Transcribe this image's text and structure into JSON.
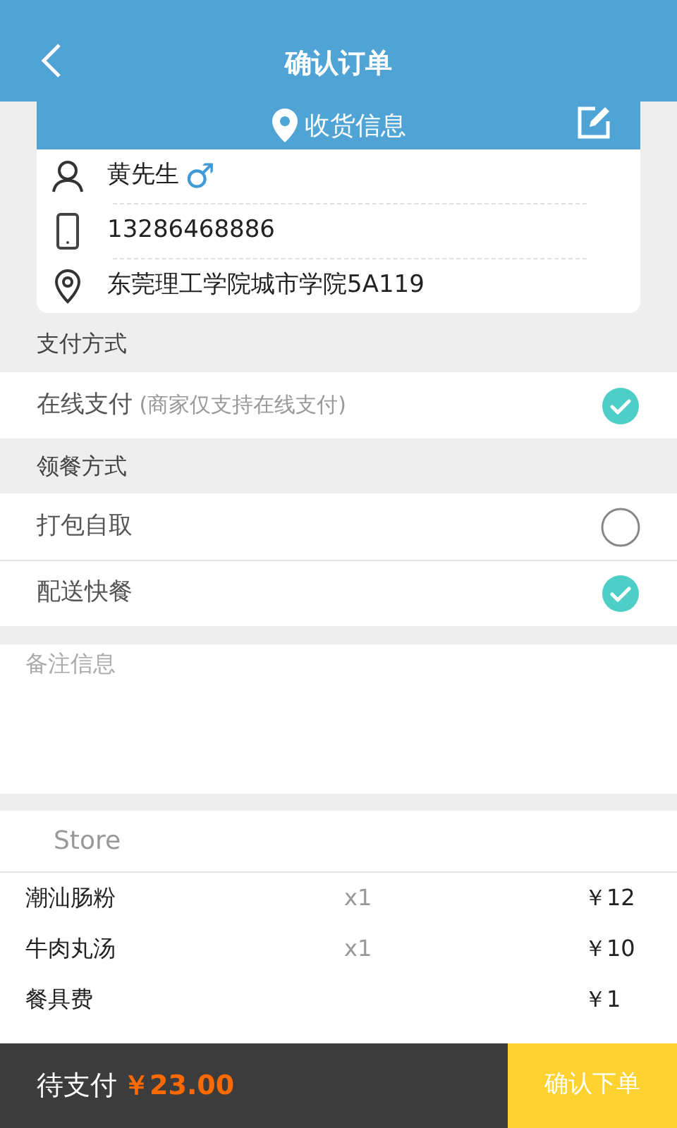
{
  "header": {
    "title": "确认订单"
  },
  "address_card": {
    "title": "收货信息",
    "name": "黄先生",
    "gender_symbol": "♂",
    "phone": "13286468886",
    "address": "东莞理工学院城市学院5A119"
  },
  "payment": {
    "label": "支付方式",
    "options": [
      {
        "label": "在线支付",
        "note": "(商家仅支持在线支付)",
        "selected": true
      }
    ]
  },
  "pickup": {
    "label": "领餐方式",
    "options": [
      {
        "label": "打包自取",
        "selected": false
      },
      {
        "label": "配送快餐",
        "selected": true
      }
    ]
  },
  "remark": {
    "placeholder": "备注信息"
  },
  "order": {
    "store": "Store",
    "items": [
      {
        "name": "潮汕肠粉",
        "qty": "x1",
        "price": "￥12"
      },
      {
        "name": "牛肉丸汤",
        "qty": "x1",
        "price": "￥10"
      },
      {
        "name": "餐具费",
        "price": "￥1"
      }
    ]
  },
  "footer": {
    "label": "待支付",
    "total": "￥23.00",
    "button": "确认下单"
  }
}
